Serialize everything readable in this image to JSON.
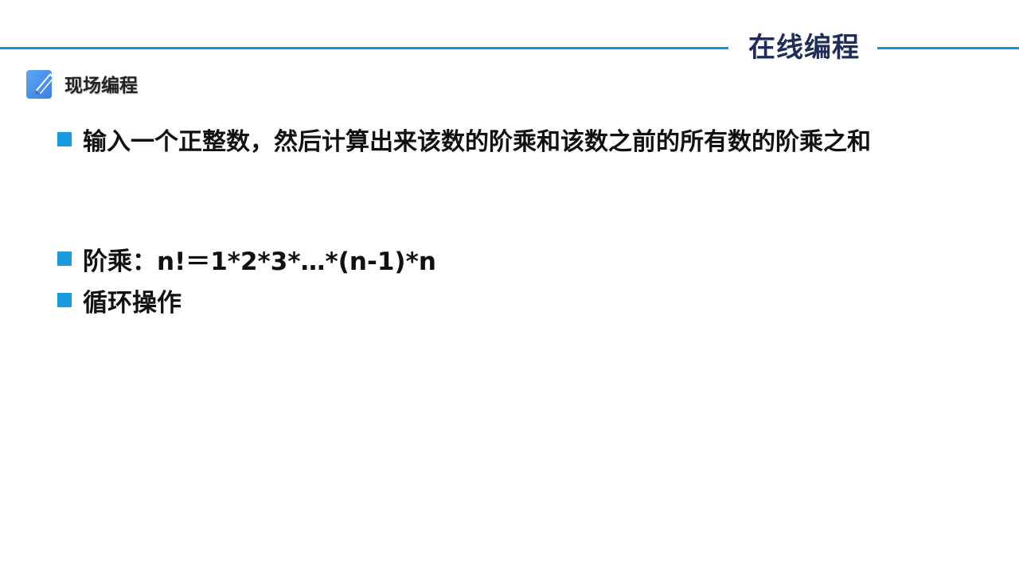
{
  "header": {
    "title": "在线编程"
  },
  "section": {
    "label": "现场编程",
    "icon": "edit-pencil-icon"
  },
  "bullets": [
    {
      "text": "输入一个正整数，然后计算出来该数的阶乘和该数之前的所有数的阶乘之和"
    },
    {
      "text": "阶乘：n!＝1*2*3*…*(n-1)*n"
    },
    {
      "text": "循环操作"
    }
  ],
  "colors": {
    "accent": "#1a8fd8",
    "bullet": "#1a9be0",
    "title": "#1f2d5a"
  }
}
